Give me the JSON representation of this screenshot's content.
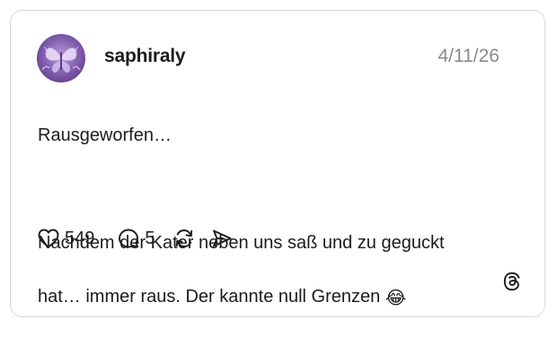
{
  "post": {
    "username": "saphiraly",
    "date": "4/11/26",
    "text_line_1": "Rausgeworfen…",
    "text_line_2": "Nachdem der Kater neben uns saß und zu geguckt",
    "text_line_3": "hat… immer raus. Der kannte null Grenzen",
    "emoji": "😂"
  },
  "actions": {
    "like_count": "549",
    "reply_count": "5",
    "like_icon": "heart-icon",
    "reply_icon": "comment-icon",
    "repost_icon": "repost-icon",
    "share_icon": "send-icon"
  },
  "branding": {
    "logo_icon": "threads-logo-icon"
  },
  "colors": {
    "text": "#1c1c1c",
    "muted": "#8a8a8a",
    "border": "#d9d9d9",
    "avatar": "#7b58a8"
  }
}
